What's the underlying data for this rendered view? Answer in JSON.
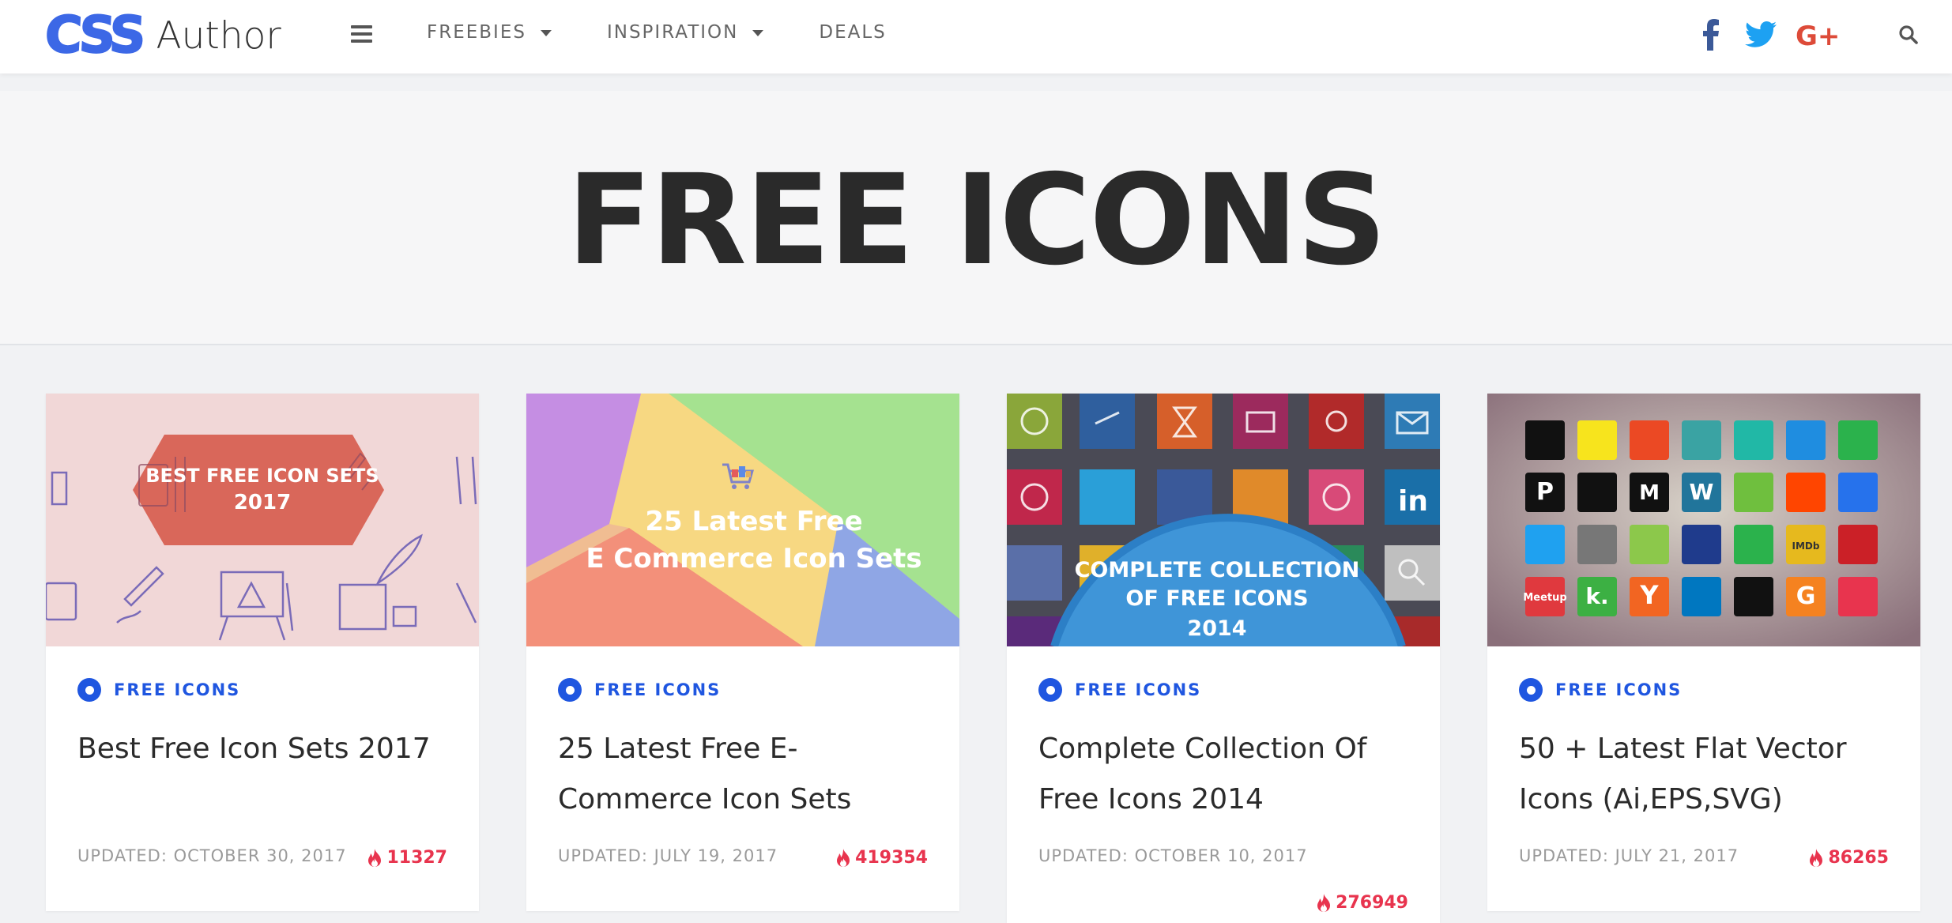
{
  "header": {
    "logo_mark": "CSS",
    "logo_word": "Author",
    "nav": [
      {
        "label": "FREEBIES",
        "has_dropdown": true
      },
      {
        "label": "INSPIRATION",
        "has_dropdown": true
      },
      {
        "label": "DEALS",
        "has_dropdown": false
      }
    ],
    "social_icons": [
      "facebook-icon",
      "twitter-icon",
      "google-plus-icon"
    ],
    "colors": {
      "facebook": "#3b5998",
      "twitter": "#1da1f2",
      "google_plus": "#dd4b39",
      "brand": "#3c68e6"
    }
  },
  "hero": {
    "title": "FREE ICONS"
  },
  "cards": [
    {
      "thumb_text": [
        "BEST FREE ICON SETS",
        "2017"
      ],
      "category": "FREE ICONS",
      "title": "Best Free Icon Sets 2017",
      "updated": "UPDATED: OCTOBER 30, 2017",
      "views": "11327"
    },
    {
      "thumb_text": [
        "25 Latest Free",
        "E Commerce Icon Sets"
      ],
      "category": "FREE ICONS",
      "title": "25 Latest Free E-Commerce Icon Sets",
      "updated": "UPDATED: JULY 19, 2017",
      "views": "419354"
    },
    {
      "thumb_text": [
        "COMPLETE COLLECTION",
        "OF FREE ICONS",
        "2014"
      ],
      "category": "FREE ICONS",
      "title": "Complete Collection Of Free Icons 2014",
      "updated": "UPDATED: OCTOBER 10, 2017",
      "views": "276949"
    },
    {
      "thumb_text": [],
      "category": "FREE ICONS",
      "title": "50 + Latest Flat Vector Icons (Ai,EPS,SVG)",
      "updated": "UPDATED: JULY 21, 2017",
      "views": "86265"
    }
  ],
  "accent_colors": {
    "category": "#1f56e0",
    "views": "#e8344e"
  }
}
